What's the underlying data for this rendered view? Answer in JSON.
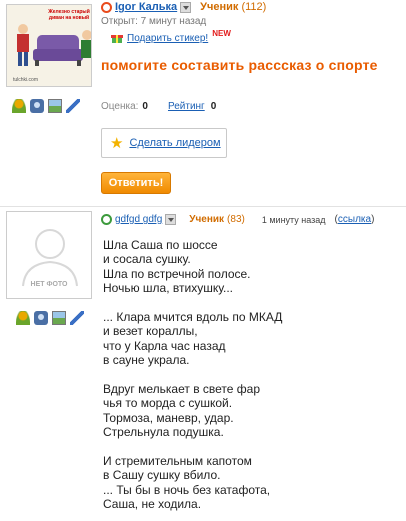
{
  "question": {
    "author": "Igor Калька",
    "rank": "Ученик",
    "rank_points": "(112)",
    "opened": "Открыт: 7 минут назад",
    "gift_sticker": "Подарить стикер!",
    "new_badge": "NEW",
    "title": "помогите составить расссказ о спорте",
    "rating_label": "Оценка:",
    "rating_value": "0",
    "score_label": "Рейтинг",
    "score_value": "0",
    "make_leader": "Сделать лидером",
    "answer_button": "Ответить!",
    "avatar_caption_line1": "Железно старый",
    "avatar_caption_line2": "диван на новый",
    "avatar_site": "tulchki.com"
  },
  "answer": {
    "author": "gdfgd gdfg",
    "rank": "Ученик",
    "rank_points": "(83)",
    "time": "1 минуту назад",
    "link_label": "ссылка",
    "no_photo": "НЕТ ФОТО",
    "lines": [
      "Шла Саша по шоссе",
      "и сосала сушку.",
      "Шла по встречной полосе.",
      "Ночью шла, втихушку...",
      "",
      "... Клара мчится вдоль по МКАД",
      "и везет кораллы,",
      "что у Карла час назад",
      "в сауне украла.",
      "",
      "Вдруг мелькает в свете фар",
      "чья то морда с сушкой.",
      "Тормоза, маневр, удар.",
      "Стрельнула подушка.",
      "",
      "И стремительным капотом",
      "в Сашу сушку вбило.",
      "... Ты бы в ночь без катафота,",
      "Саша, не ходила."
    ]
  },
  "colors": {
    "accent_orange": "#e95c00",
    "link_blue": "#1a5fb4",
    "rank_orange": "#d16c00",
    "button_orange": "#f08a00"
  }
}
